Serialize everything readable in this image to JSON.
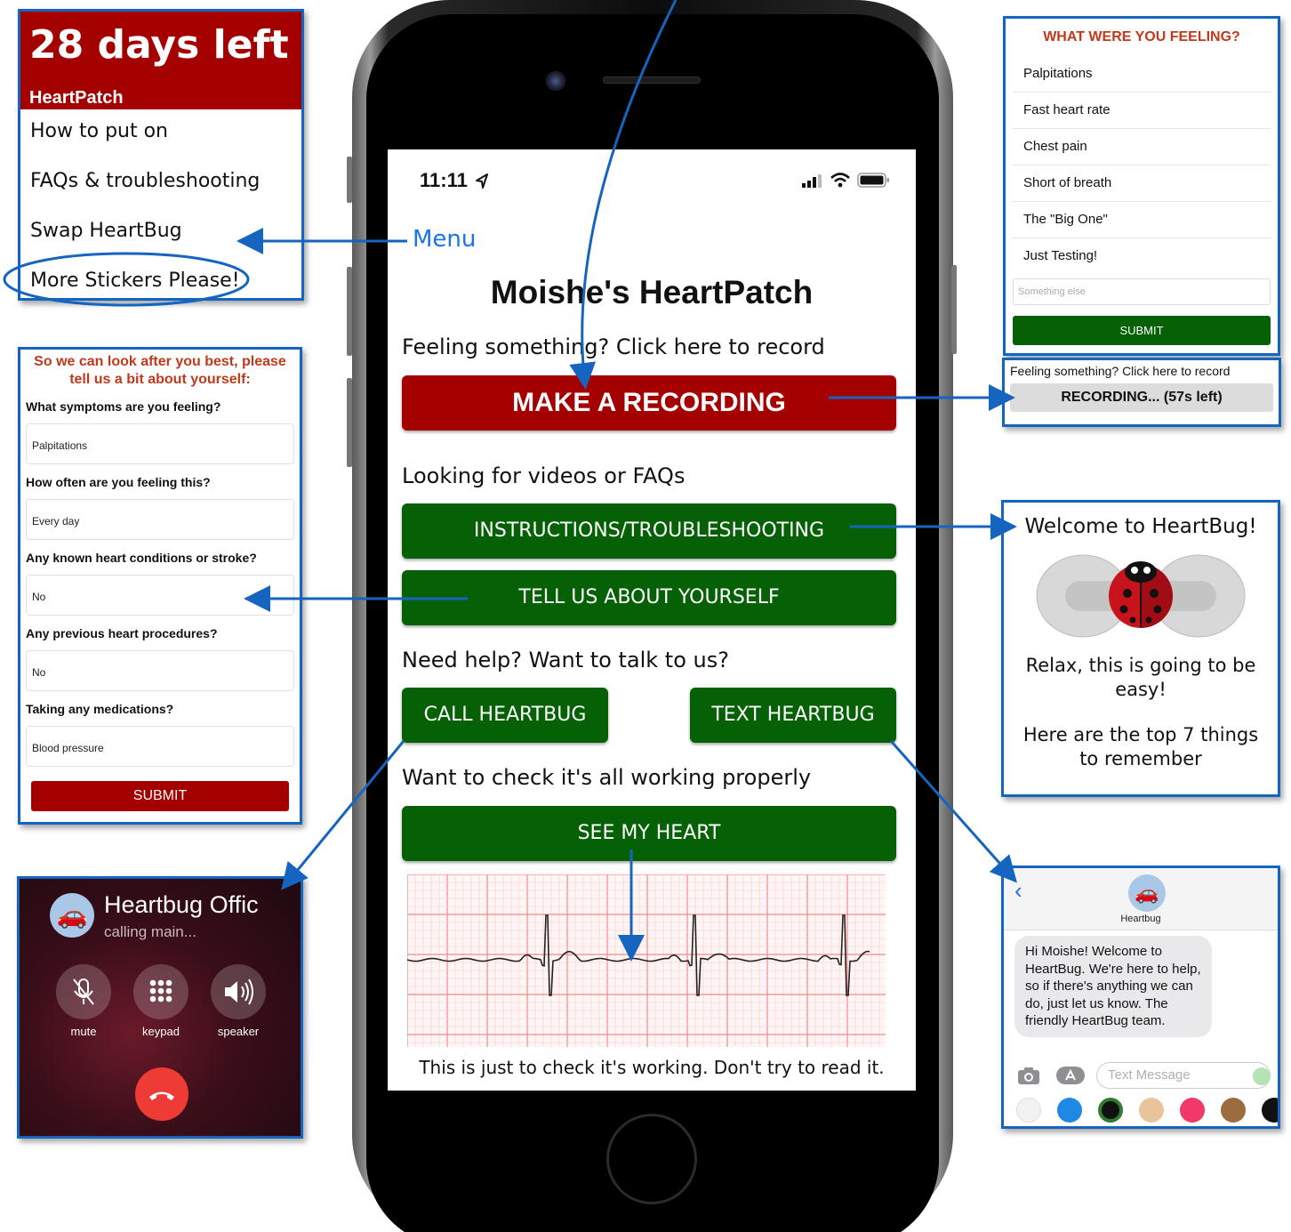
{
  "menu_panel": {
    "days_left": "28 days left",
    "brand": "HeartPatch",
    "items": [
      "How to put on",
      "FAQs & troubleshooting",
      "Swap HeartBug",
      "More Stickers Please!"
    ]
  },
  "profile_form": {
    "intro": "So we can look after you best, please tell us a bit about yourself:",
    "fields": [
      {
        "question": "What symptoms are you feeling?",
        "answer": "Palpitations"
      },
      {
        "question": "How often are you feeling this?",
        "answer": "Every day"
      },
      {
        "question": "Any known heart conditions or stroke?",
        "answer": "No"
      },
      {
        "question": "Any previous heart procedures?",
        "answer": "No"
      },
      {
        "question": "Taking any medications?",
        "answer": "Blood pressure"
      }
    ],
    "submit_label": "SUBMIT"
  },
  "call_screen": {
    "caller": "Heartbug Offic",
    "status": "calling main...",
    "buttons": [
      "mute",
      "keypad",
      "speaker"
    ]
  },
  "phone_app": {
    "time": "11:11",
    "menu_label": "Menu",
    "title": "Moishe's HeartPatch",
    "record_prompt": "Feeling something? Click here to record",
    "record_button": "MAKE A RECORDING",
    "videos_prompt": "Looking for videos or FAQs",
    "instructions_button": "INSTRUCTIONS/TROUBLESHOOTING",
    "about_button": "TELL US ABOUT YOURSELF",
    "help_prompt": "Need help? Want to talk to us?",
    "call_button": "CALL HEARTBUG",
    "text_button": "TEXT HEARTBUG",
    "check_prompt": "Want to check it's all working properly",
    "heart_button": "SEE MY HEART",
    "ecg_note": "This is just to check it's working. Don't try to read it."
  },
  "feelings_panel": {
    "title": "WHAT WERE YOU FEELING?",
    "options": [
      "Palpitations",
      "Fast heart rate",
      "Chest pain",
      "Short of breath",
      "The \"Big One\"",
      "Just Testing!"
    ],
    "other_placeholder": "Something else",
    "submit_label": "SUBMIT"
  },
  "recording_panel": {
    "prompt": "Feeling something? Click here to record",
    "status": "RECORDING... (57s left)"
  },
  "welcome_panel": {
    "title": "Welcome to HeartBug!",
    "relax": "Relax, this is going to be easy!",
    "top_things": "Here are the top 7 things to remember"
  },
  "messages_panel": {
    "contact": "Heartbug",
    "message": "Hi Moishe! Welcome to HeartBug. We're here to help, so if there's anything we can do, just let us know. The friendly HeartBug team.",
    "input_placeholder": "Text Message"
  },
  "colors": {
    "annotation_blue": "#1565c0",
    "brand_red": "#a50000",
    "brand_green": "#066106",
    "link_blue": "#1a73e8",
    "form_heading": "#c0391b"
  }
}
